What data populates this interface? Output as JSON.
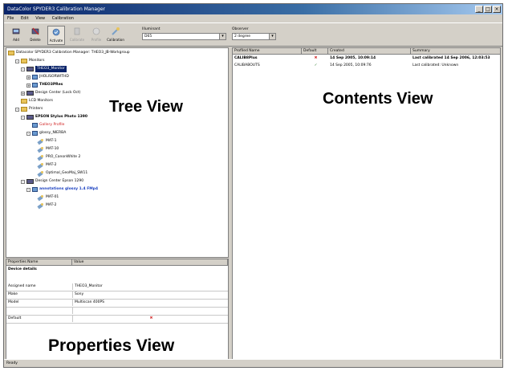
{
  "window": {
    "title": "DataColor SPYDER3 Calibration Manager"
  },
  "menubar": [
    "File",
    "Edit",
    "View",
    "Calibration"
  ],
  "toolbar": {
    "buttons": [
      {
        "label": "Add",
        "icon": "add-icon",
        "disabled": false
      },
      {
        "label": "Delete",
        "icon": "delete-icon",
        "disabled": false
      },
      {
        "label": "Activate",
        "icon": "activate-icon",
        "disabled": false
      },
      {
        "label": "Calibrate",
        "icon": "calibrate-icon",
        "disabled": true
      },
      {
        "label": "Profile",
        "icon": "profile-icon",
        "disabled": true
      },
      {
        "label": "Calibration",
        "icon": "calibration-icon",
        "disabled": false
      }
    ],
    "illuminant_label": "Illuminant",
    "illuminant_value": "D65",
    "observer_label": "Observer",
    "observer_value": "2 degree"
  },
  "tree": {
    "root": "Datacolor SPYDER3 Calibration Manager: THEO3_JB-Workgroup",
    "items": [
      {
        "text": "Monitors",
        "indent": 1,
        "icon": "folder",
        "exp": "-"
      },
      {
        "text": "THEO3_Monitor",
        "indent": 2,
        "icon": "device",
        "exp": "-",
        "style": "selected"
      },
      {
        "text": "JHOLISORWITHD",
        "indent": 3,
        "icon": "display",
        "exp": "+"
      },
      {
        "text": "THEO3PRes",
        "indent": 3,
        "icon": "display",
        "exp": "+",
        "style": "bold"
      },
      {
        "text": "Design Center (Lock Oct)",
        "indent": 2,
        "icon": "device",
        "exp": "+"
      },
      {
        "text": "LCD Monitors",
        "indent": 1,
        "icon": "folder",
        "exp": ""
      },
      {
        "text": "Printers",
        "indent": 1,
        "icon": "folder",
        "exp": "-"
      },
      {
        "text": "EPSON Stylus Photo 1390",
        "indent": 2,
        "icon": "device",
        "exp": "-",
        "style": "bold"
      },
      {
        "text": "Gallery Profile",
        "indent": 3,
        "icon": "display",
        "exp": "",
        "style": "red"
      },
      {
        "text": "glossy_NIERBA",
        "indent": 3,
        "icon": "display",
        "exp": "-"
      },
      {
        "text": "MAT-1",
        "indent": 4,
        "icon": "calib",
        "exp": ""
      },
      {
        "text": "MAT-10",
        "indent": 4,
        "icon": "calib",
        "exp": ""
      },
      {
        "text": "PRO_CanonWhite 2",
        "indent": 4,
        "icon": "calib",
        "exp": ""
      },
      {
        "text": "MAT-2",
        "indent": 4,
        "icon": "calib",
        "exp": ""
      },
      {
        "text": "Optimal_GeoMaj_SW11",
        "indent": 4,
        "icon": "calib",
        "exp": ""
      },
      {
        "text": "Design Center Epson 1290",
        "indent": 2,
        "icon": "device",
        "exp": "-"
      },
      {
        "text": "annotations glossy 1.4 FMp4",
        "indent": 3,
        "icon": "display",
        "exp": "-",
        "style": "blue"
      },
      {
        "text": "MAT-01",
        "indent": 4,
        "icon": "calib",
        "exp": ""
      },
      {
        "text": "MAT-2",
        "indent": 4,
        "icon": "calib",
        "exp": ""
      }
    ]
  },
  "contents": {
    "columns": [
      "Profiled Name",
      "Default",
      "Created",
      "Summary"
    ],
    "rows": [
      {
        "name": "CALIB8Plus",
        "default_mark": "✖",
        "created": "14 Sep 2005, 10:09:14",
        "summary": "Last calibrated 14 Sep 2006, 12:03:53",
        "bold": true
      },
      {
        "name": "CALIBABOUTS",
        "default_mark": "✓",
        "created": "14 Sep 2005, 10:09:76",
        "summary": "Last calibrated: Unknown",
        "bold": false
      }
    ]
  },
  "properties": {
    "columns": [
      "Properties Name",
      "Value"
    ],
    "section": "Device details",
    "rows": [
      {
        "name": "Assigned name",
        "value": "THEO3_Monitor"
      },
      {
        "name": "Make",
        "value": "Sony"
      },
      {
        "name": "Model",
        "value": "Multiscan 400PS"
      },
      {
        "name": "",
        "value": ""
      },
      {
        "name": "Default",
        "value": "✖"
      }
    ]
  },
  "labels": {
    "tree_view": "Tree View",
    "contents_view": "Contents View",
    "properties_view": "Properties View"
  },
  "status": "Ready",
  "colors": {
    "title_start": "#0a246a",
    "selection": "#0a246a",
    "red_mark": "#d02020",
    "face": "#d4d0c8"
  }
}
